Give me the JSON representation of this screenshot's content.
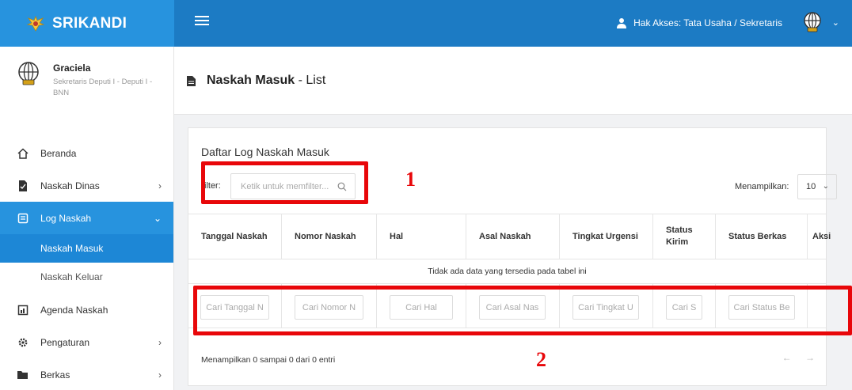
{
  "app": {
    "name": "SRIKANDI"
  },
  "topbar": {
    "role_text": "Hak Akses: Tata Usaha / Sekretaris"
  },
  "user": {
    "name": "Graciela",
    "role": "Sekretaris Deputi I - Deputi I - BNN"
  },
  "sidebar": {
    "items": [
      {
        "label": "Beranda",
        "icon": "home-icon",
        "chevron": ""
      },
      {
        "label": "Naskah Dinas",
        "icon": "document-icon",
        "chevron": "›"
      },
      {
        "label": "Log Naskah",
        "icon": "log-icon",
        "chevron": "⌄"
      },
      {
        "label": "Agenda Naskah",
        "icon": "agenda-icon",
        "chevron": ""
      },
      {
        "label": "Pengaturan",
        "icon": "gear-icon",
        "chevron": "›"
      },
      {
        "label": "Berkas",
        "icon": "folder-icon",
        "chevron": "›"
      }
    ],
    "sub_items": [
      {
        "label": "Naskah Masuk"
      },
      {
        "label": "Naskah Keluar"
      }
    ]
  },
  "page": {
    "title_bold": "Naskah Masuk",
    "title_rest": " - List"
  },
  "card": {
    "title": "Daftar Log Naskah Masuk",
    "filter_label": "ilter:",
    "filter_placeholder": "Ketik untuk memfilter...",
    "show_label": "Menampilkan:",
    "show_value": "10"
  },
  "table": {
    "columns": [
      {
        "label": "Tanggal Naskah",
        "search": "Cari Tanggal N"
      },
      {
        "label": "Nomor Naskah",
        "search": "Cari Nomor N"
      },
      {
        "label": "Hal",
        "search": "Cari Hal"
      },
      {
        "label": "Asal Naskah",
        "search": "Cari Asal Nas"
      },
      {
        "label": "Tingkat Urgensi",
        "search": "Cari Tingkat U"
      },
      {
        "label": "Status Kirim",
        "search": "Cari S"
      },
      {
        "label": "Status Berkas",
        "search": "Cari Status Be"
      },
      {
        "label": "Aksi",
        "search": ""
      }
    ],
    "empty_text": "Tidak ada data yang tersedia pada tabel ini",
    "info": "Menampilkan 0 sampai 0 dari 0 entri",
    "pager_prev": "←",
    "pager_next": "→"
  },
  "annotations": {
    "label_1": "1",
    "label_2": "2",
    "color": "#e8070a"
  },
  "colors": {
    "brand": "#2793de",
    "topbar": "#1c7bc4",
    "active_sub": "#1d87d6"
  }
}
